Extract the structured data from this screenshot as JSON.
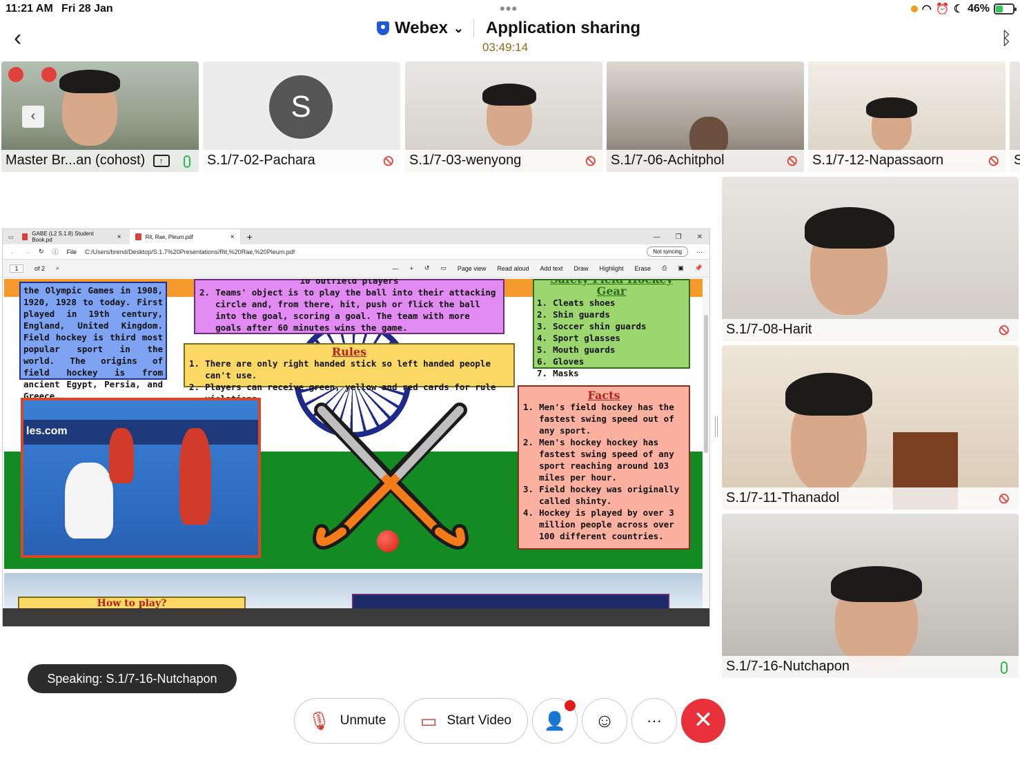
{
  "status": {
    "time": "11:21 AM",
    "date": "Fri 28 Jan",
    "battery": "46%"
  },
  "header": {
    "app": "Webex",
    "title": "Application sharing",
    "timer": "03:49:14"
  },
  "strip": [
    {
      "name": "Master Br...an (cohost)",
      "muted": false
    },
    {
      "name": "S.1/7-02-Pachara",
      "avatar": "S",
      "muted": true
    },
    {
      "name": "S.1/7-03-wenyong",
      "muted": true
    },
    {
      "name": "S.1/7-06-Achitphol",
      "muted": true
    },
    {
      "name": "S.1/7-12-Napassaorn",
      "muted": true
    },
    {
      "name": "S"
    }
  ],
  "right_tiles": [
    {
      "name": "S.1/7-08-Harit",
      "muted": true
    },
    {
      "name": "S.1/7-11-Thanadol",
      "muted": true
    },
    {
      "name": "S.1/7-16-Nutchapon",
      "muted": false
    }
  ],
  "browser": {
    "tab1": "GABE (L2 S.1.8) Student Book.pd",
    "tab2": "Rit, Rae, Pleum.pdf",
    "file_label": "File",
    "url": "C:/Users/brend/Desktop/S.1.7%20Presentations/Rit,%20Rae,%20Pleum.pdf",
    "sync": "Not syncing",
    "page_num": "1",
    "page_of": "of 2",
    "tools": {
      "page_view": "Page view",
      "read_aloud": "Read aloud",
      "add_text": "Add text",
      "draw": "Draw",
      "highlight": "Highlight",
      "erase": "Erase"
    }
  },
  "slide": {
    "history_text": "the Olympic Games in 1908, 1920, 1928 to today. First played in 19th century, England, United Kingdom. Field hockey is third most popular sport in the world. The origins of field hockey is from ancient Egypt, Persia, and Greece.",
    "objective": {
      "partial_top": "10 outfield players",
      "item_num": "2.",
      "item": "Teams' object is to play the ball into their attacking circle and, from there, hit, push or flick the ball into the goal, scoring a goal. The team with more goals after 60 minutes wins the game."
    },
    "safety": {
      "title_partial": "Safety Field Hockey Gear",
      "items": [
        "Cleats shoes",
        "Shin guards",
        "Soccer shin guards",
        "Sport glasses",
        "Mouth guards",
        "Gloves",
        "Masks"
      ]
    },
    "rules": {
      "title": "Rules",
      "items": [
        "There are only right handed stick so left handed people can't use.",
        "Players can receive green, yellow and red cards for rule violations."
      ]
    },
    "facts": {
      "title": "Facts",
      "items": [
        "Men's field hockey has the fastest swing speed out of any sport.",
        "Men's hockey hockey has fastest swing  speed of any sport reaching around 103 miles per hour.",
        "Field hockey was originally called shinty.",
        "Hockey is played by over 3 million people across over 100 different countries."
      ]
    },
    "howto": "How to play?",
    "photo_watermark": "les.com"
  },
  "speaking": "Speaking: S.1/7-16-Nutchapon",
  "controls": {
    "unmute": "Unmute",
    "start_video": "Start Video"
  },
  "colors": {
    "accent_red": "#e8313a",
    "mute_red": "#e0413a",
    "mic_green": "#2fb84a"
  }
}
